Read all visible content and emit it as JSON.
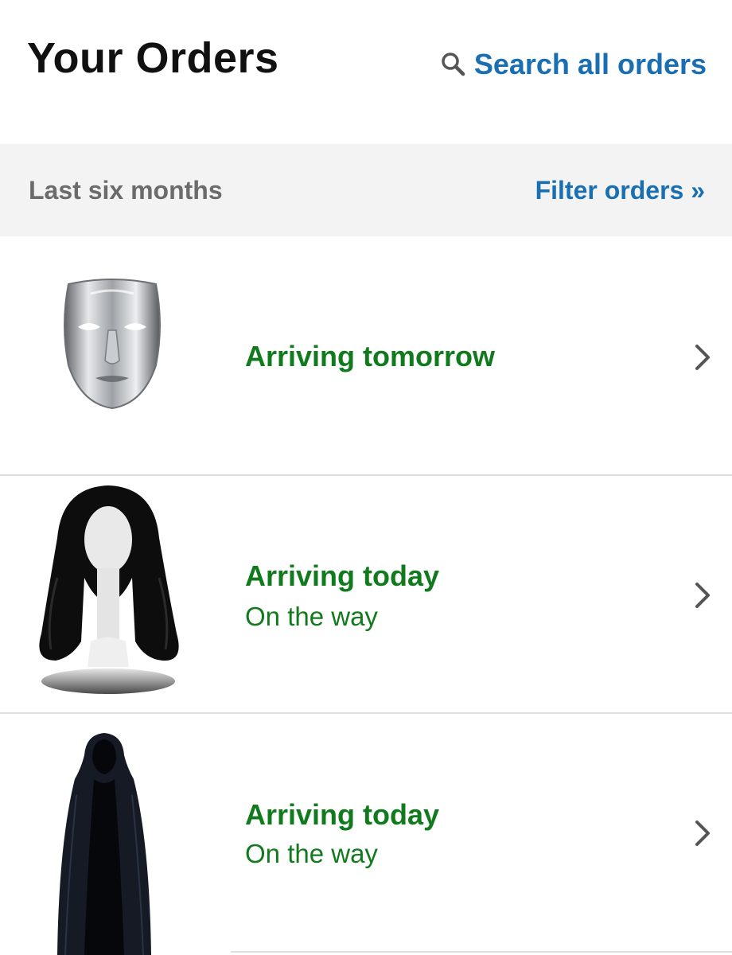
{
  "header": {
    "title": "Your Orders",
    "search_label": "Search all orders",
    "search_icon": "search-icon"
  },
  "filter": {
    "range_label": "Last six months",
    "filter_label": "Filter orders »"
  },
  "orders": [
    {
      "status": "Arriving tomorrow",
      "sub": "",
      "thumbnail": "silver-mask-image"
    },
    {
      "status": "Arriving today",
      "sub": "On the way",
      "thumbnail": "black-wig-image"
    },
    {
      "status": "Arriving today",
      "sub": "On the way",
      "thumbnail": "black-cloak-image"
    }
  ],
  "colors": {
    "link_blue": "#1a6fb3",
    "status_green": "#117a1d",
    "filter_bg": "#f3f3f3"
  }
}
